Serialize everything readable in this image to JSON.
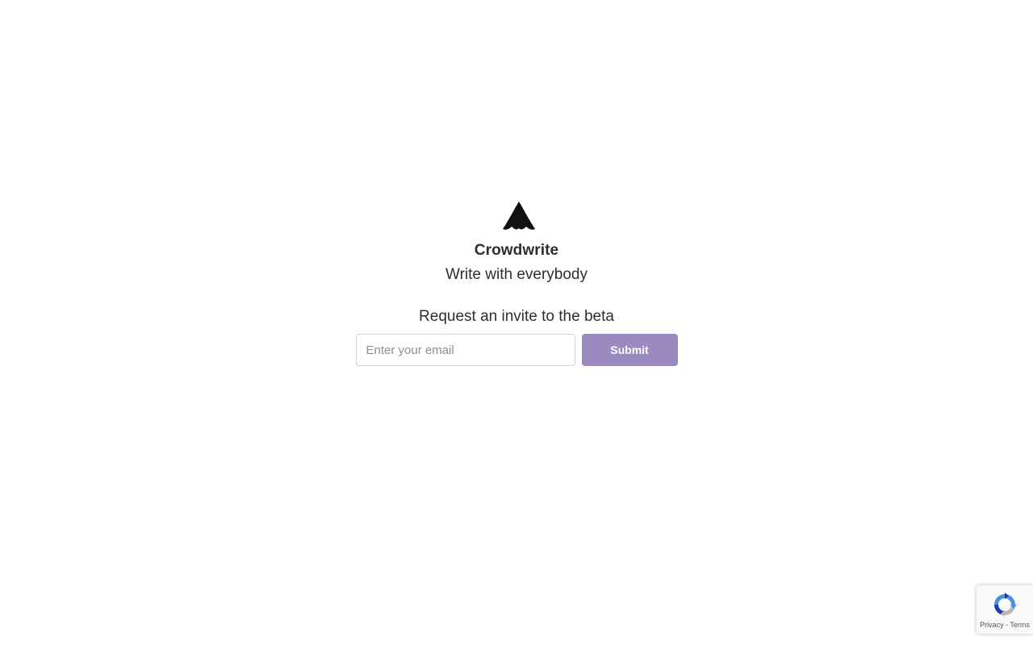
{
  "brand": {
    "logo_icon": "crowdwrite-logo-icon",
    "name": "Crowdwrite",
    "tagline": "Write with everybody"
  },
  "invite": {
    "heading": "Request an invite to the beta",
    "email_placeholder": "Enter your email",
    "email_value": "",
    "submit_label": "Submit"
  },
  "recaptcha": {
    "icon": "recaptcha-icon",
    "privacy_label": "Privacy",
    "separator": " - ",
    "terms_label": "Terms"
  },
  "colors": {
    "submit_bg": "#9b8ac0",
    "text": "#2b2f33",
    "background": "#ffffff"
  }
}
